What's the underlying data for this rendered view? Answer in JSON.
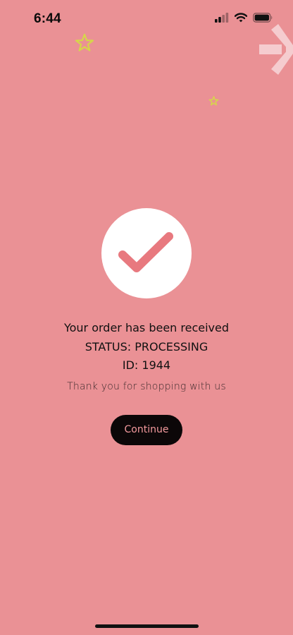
{
  "colors": {
    "background": "#ea9195",
    "accent": "#e8797f",
    "star": "#d6d64a",
    "button_bg": "#0c0708",
    "button_text": "#f49a9e"
  },
  "status_bar": {
    "time": "6:44",
    "icons": [
      "cellular-signal-icon",
      "wifi-icon",
      "battery-icon"
    ]
  },
  "decorations": [
    "star-icon",
    "star-icon",
    "asterisk-logo-icon"
  ],
  "confirmation": {
    "icon": "checkmark-icon",
    "title": "Your order has been received",
    "status": "STATUS: PROCESSING",
    "id": "ID: 1944",
    "thanks": "Thank you for shopping with us"
  },
  "actions": {
    "continue_label": "Continue"
  }
}
